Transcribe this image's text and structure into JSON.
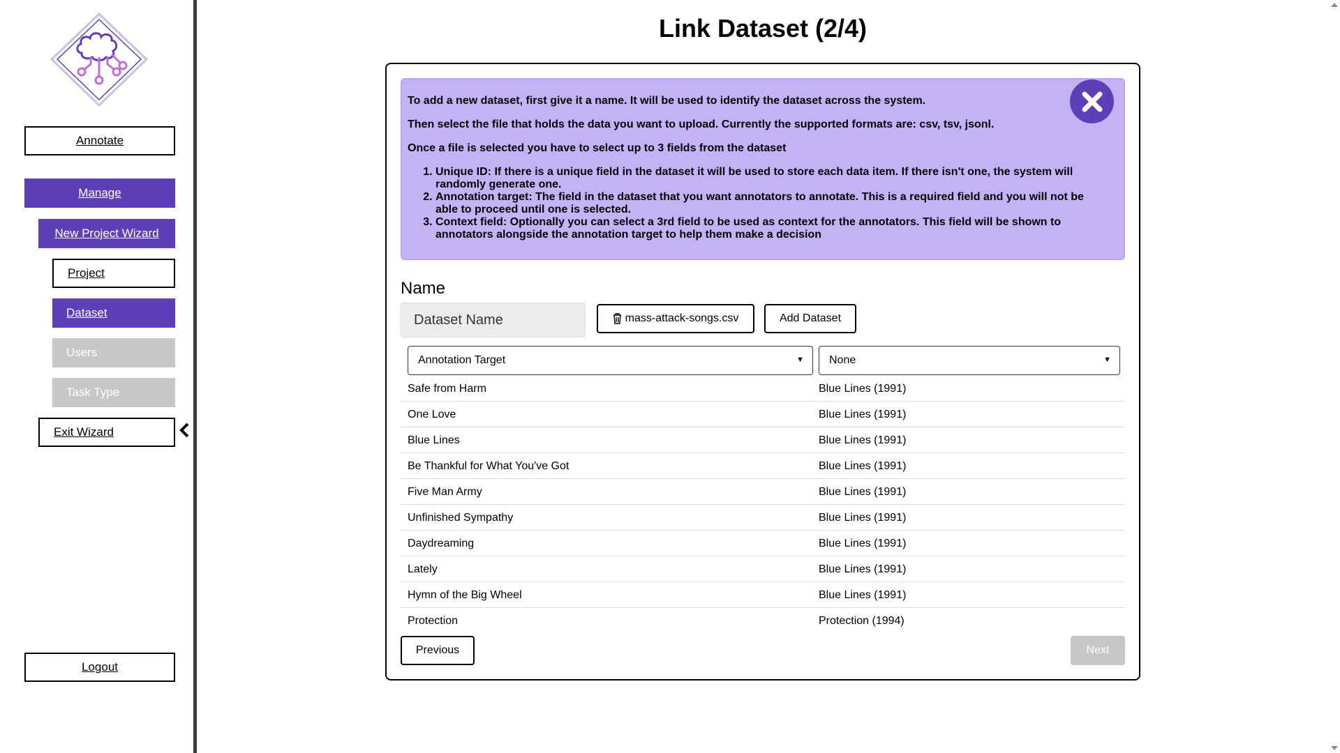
{
  "sidebar": {
    "annotate": "Annotate",
    "manage": "Manage",
    "wizard": "New Project Wizard",
    "project": "Project",
    "dataset": "Dataset",
    "users": "Users",
    "task_type": "Task Type",
    "exit": "Exit Wizard",
    "logout": "Logout"
  },
  "title": "Link Dataset (2/4)",
  "info": {
    "p1": "To add a new dataset, first give it a name. It will be used to identify the dataset across the system.",
    "p2": "Then select the file that holds the data you want to upload. Currently the supported formats are: csv, tsv, jsonl.",
    "p3": "Once a file is selected you have to select up to 3 fields from the dataset",
    "items": [
      "Unique ID: If there is a unique field in the dataset it will be used to store each data item. If there isn't one, the system will randomly generate one.",
      "Annotation target: The field in the dataset that you want annotators to annotate. This is a required field and you will not be able to proceed until one is selected.",
      "Context field: Optionally you can select a 3rd field to be used as context for the annotators. This field will be shown to annotators alongside the annotation target to help them make a decision"
    ]
  },
  "form": {
    "name_label": "Name",
    "name_placeholder": "Dataset Name",
    "file_button": "mass-attack-songs.csv",
    "add_button": "Add Dataset",
    "select_target": "Annotation Target",
    "select_context": "None"
  },
  "rows": [
    {
      "target": "Safe from Harm",
      "context": "Blue Lines (1991)"
    },
    {
      "target": "One Love",
      "context": "Blue Lines (1991)"
    },
    {
      "target": "Blue Lines",
      "context": "Blue Lines (1991)"
    },
    {
      "target": "Be Thankful for What You've Got",
      "context": "Blue Lines (1991)"
    },
    {
      "target": "Five Man Army",
      "context": "Blue Lines (1991)"
    },
    {
      "target": "Unfinished Sympathy",
      "context": "Blue Lines (1991)"
    },
    {
      "target": "Daydreaming",
      "context": "Blue Lines (1991)"
    },
    {
      "target": "Lately",
      "context": "Blue Lines (1991)"
    },
    {
      "target": "Hymn of the Big Wheel",
      "context": "Blue Lines (1991)"
    },
    {
      "target": "Protection",
      "context": "Protection (1994)"
    }
  ],
  "footer": {
    "previous": "Previous",
    "next": "Next"
  },
  "colors": {
    "accent": "#5e3fb7",
    "info_bg": "#c3b2f5",
    "disabled": "#c7c7c7"
  }
}
